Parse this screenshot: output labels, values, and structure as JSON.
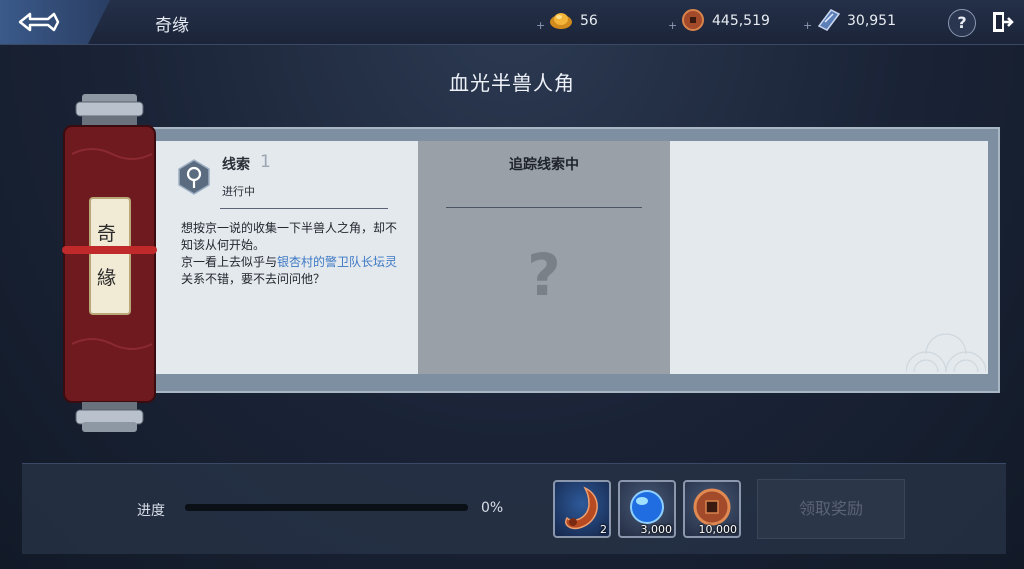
{
  "header": {
    "title": "奇缘"
  },
  "resources": [
    {
      "name": "gold-ingot",
      "value": "56"
    },
    {
      "name": "copper-coin",
      "value": "445,519"
    },
    {
      "name": "silver-ticket",
      "value": "30,951"
    }
  ],
  "help_label": "?",
  "scroll": {
    "title": "血光半兽人角",
    "tag_chars": [
      "奇",
      "緣"
    ],
    "clue": {
      "label": "线索",
      "number": "1",
      "status": "进行中",
      "desc_part1": "想按京一说的收集一下半兽人之角，却不知该从何开始。",
      "desc_part2": "京一看上去似乎与",
      "desc_link": "银杏村的警卫队长坛灵",
      "desc_part3": "关系不错，要不去问问他？"
    },
    "tracking": {
      "title": "追踪线索中",
      "placeholder": "?"
    }
  },
  "progress": {
    "label": "进度",
    "percent_text": "0%",
    "fraction": 0
  },
  "rewards": [
    {
      "name": "orc-horn",
      "count": "2"
    },
    {
      "name": "blue-gem",
      "count": "3,000"
    },
    {
      "name": "copper-coin",
      "count": "10,000"
    }
  ],
  "claim_button": "领取奖励",
  "colors": {
    "accent_link": "#3d78c4",
    "progress_fill": "#c8a04a",
    "scroll_red": "#6e1a1f"
  }
}
